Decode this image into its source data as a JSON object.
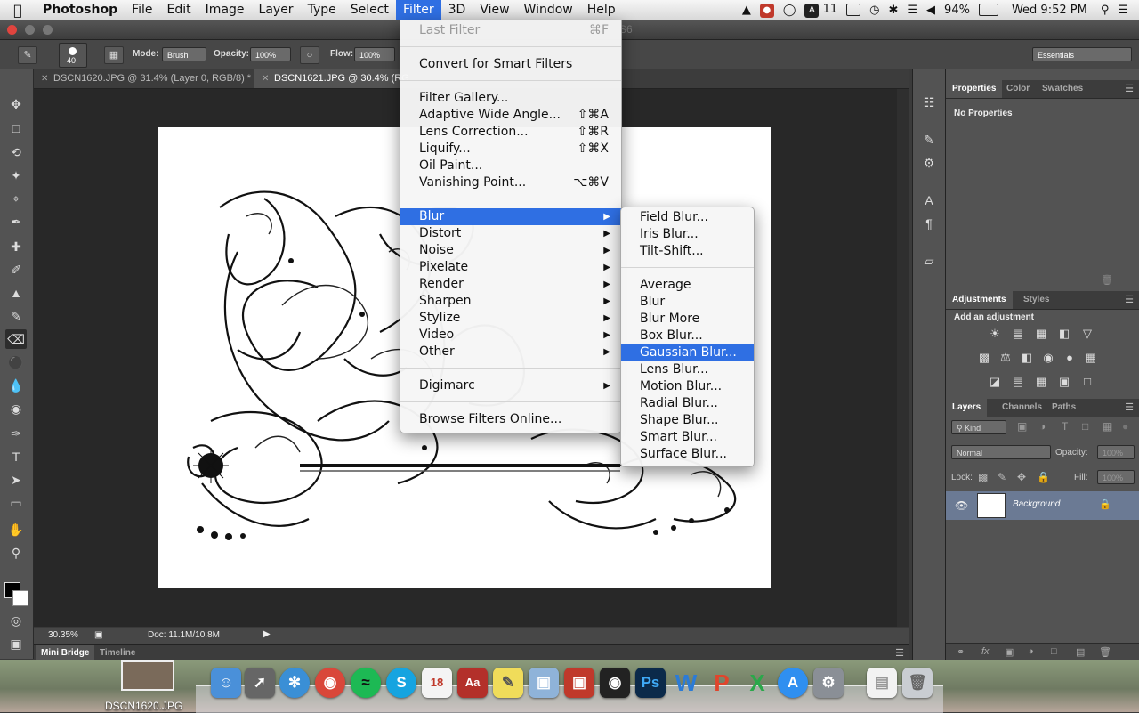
{
  "menubar": {
    "app": "Photoshop",
    "items": [
      "File",
      "Edit",
      "Image",
      "Layer",
      "Type",
      "Select",
      "Filter",
      "3D",
      "View",
      "Window",
      "Help"
    ],
    "active": "Filter",
    "status": {
      "adobe_count": "11",
      "battery": "94%",
      "clock": "Wed 9:52 PM"
    }
  },
  "title": {
    "text": "S6"
  },
  "options": {
    "brush_size": "40",
    "mode_label": "Mode:",
    "mode_value": "Brush",
    "opacity_label": "Opacity:",
    "opacity_value": "100%",
    "flow_label": "Flow:",
    "flow_value": "100%",
    "workspace": "Essentials"
  },
  "doc_tabs": [
    {
      "label": "DSCN1620.JPG @ 31.4% (Layer 0, RGB/8) *"
    },
    {
      "label": "DSCN1621.JPG @ 30.4% (RG"
    }
  ],
  "status_bar": {
    "zoom": "30.35%",
    "doc": "Doc: 11.1M/10.8M"
  },
  "bottom_tabs": {
    "mini_bridge": "Mini Bridge",
    "timeline": "Timeline"
  },
  "filter_menu": {
    "items": [
      {
        "label": "Last Filter",
        "shortcut": "⌘F",
        "disabled": true
      },
      {
        "label": "Convert for Smart Filters"
      },
      {
        "label": "Filter Gallery..."
      },
      {
        "label": "Adaptive Wide Angle...",
        "shortcut": "⇧⌘A"
      },
      {
        "label": "Lens Correction...",
        "shortcut": "⇧⌘R"
      },
      {
        "label": "Liquify...",
        "shortcut": "⇧⌘X"
      },
      {
        "label": "Oil Paint..."
      },
      {
        "label": "Vanishing Point...",
        "shortcut": "⌥⌘V"
      },
      {
        "label": "Blur",
        "submenu": true,
        "highlight": true
      },
      {
        "label": "Distort",
        "submenu": true
      },
      {
        "label": "Noise",
        "submenu": true
      },
      {
        "label": "Pixelate",
        "submenu": true
      },
      {
        "label": "Render",
        "submenu": true
      },
      {
        "label": "Sharpen",
        "submenu": true
      },
      {
        "label": "Stylize",
        "submenu": true
      },
      {
        "label": "Video",
        "submenu": true
      },
      {
        "label": "Other",
        "submenu": true
      },
      {
        "label": "Digimarc",
        "submenu": true
      },
      {
        "label": "Browse Filters Online..."
      }
    ]
  },
  "blur_menu": {
    "items": [
      {
        "label": "Field Blur..."
      },
      {
        "label": "Iris Blur..."
      },
      {
        "label": "Tilt-Shift..."
      },
      {
        "label": "Average"
      },
      {
        "label": "Blur"
      },
      {
        "label": "Blur More"
      },
      {
        "label": "Box Blur..."
      },
      {
        "label": "Gaussian Blur...",
        "highlight": true
      },
      {
        "label": "Lens Blur..."
      },
      {
        "label": "Motion Blur..."
      },
      {
        "label": "Radial Blur..."
      },
      {
        "label": "Shape Blur..."
      },
      {
        "label": "Smart Blur..."
      },
      {
        "label": "Surface Blur..."
      }
    ]
  },
  "properties_panel": {
    "tabs": [
      "Properties",
      "Color",
      "Swatches"
    ],
    "content": "No Properties"
  },
  "adjustments_panel": {
    "tabs": [
      "Adjustments",
      "Styles"
    ],
    "heading": "Add an adjustment"
  },
  "layers_panel": {
    "tabs": [
      "Layers",
      "Channels",
      "Paths"
    ],
    "filter_kind": "Kind",
    "blend_mode": "Normal",
    "opacity_label": "Opacity:",
    "opacity_value": "100%",
    "lock_label": "Lock:",
    "fill_label": "Fill:",
    "fill_value": "100%",
    "layer_name": "Background"
  },
  "desktop": {
    "file_label": "DSCN1620.JPG"
  },
  "colors": {
    "menu_highlight": "#2f6fe3",
    "panel_bg": "#535353",
    "canvas_bg": "#282828"
  }
}
